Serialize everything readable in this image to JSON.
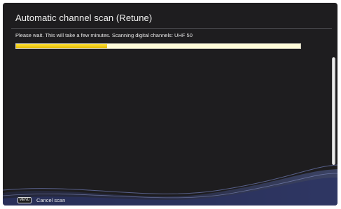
{
  "dialog": {
    "title": "Automatic channel scan (Retune)",
    "status_message": "Please wait. This will take a few minutes. Scanning digital channels: UHF 50",
    "progress_fraction": 0.32
  },
  "footer": {
    "key_label": "MENU",
    "action_label": "Cancel scan"
  },
  "colors": {
    "background": "#1e1d1f",
    "progress_fill": "#f5cc0f",
    "progress_track": "#fffbd9",
    "wave_accent": "#4a5a9a"
  }
}
